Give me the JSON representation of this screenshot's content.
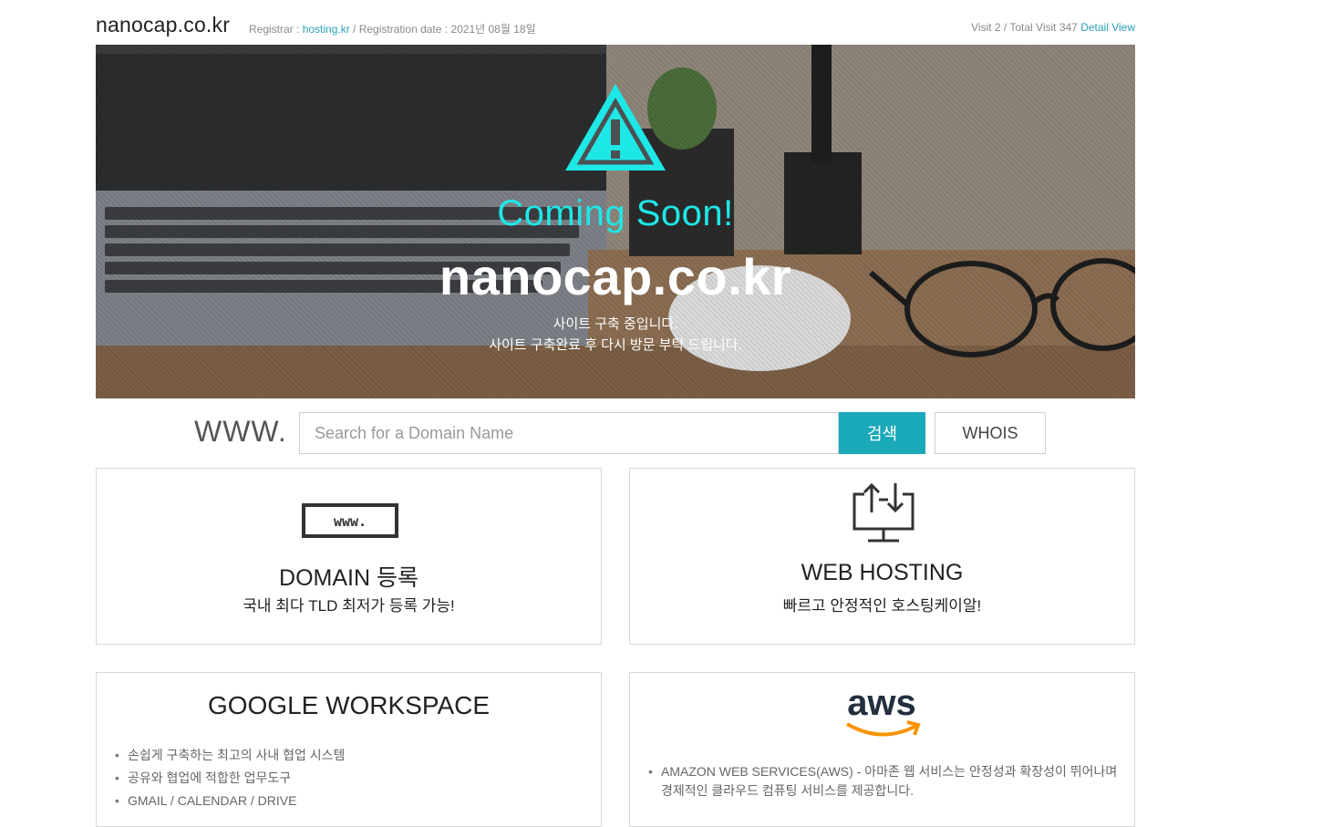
{
  "header": {
    "site_title": "nanocap.co.kr",
    "registrar_label": "Registrar : ",
    "registrar_name": "hosting.kr",
    "registration_label": " / Registration date : 2021년 08월 18일",
    "visit_text": "Visit 2 / Total Visit 347 ",
    "detail_link": "Detail View"
  },
  "hero": {
    "warning_icon": "warning-triangle-icon",
    "coming_soon": "Coming Soon!",
    "domain": "nanocap.co.kr",
    "message_line1": "사이트 구축 중입니다.",
    "message_line2": "사이트 구축완료 후 다시 방문 부탁 드립니다."
  },
  "search": {
    "prefix": "WWW.",
    "placeholder": "Search for a Domain Name",
    "value": "",
    "search_button": "검색",
    "whois_button": "WHOIS"
  },
  "cards": {
    "domain": {
      "icon": "www-icon",
      "icon_text": "www.",
      "title": "DOMAIN 등록",
      "subtitle": "국내 최다 TLD 최저가 등록 가능!"
    },
    "hosting": {
      "icon": "upload-download-monitor-icon",
      "title": "WEB HOSTING",
      "subtitle": "빠르고 안정적인 호스팅케이알!"
    },
    "google": {
      "title": "GOOGLE WORKSPACE",
      "items": [
        "손쉽게 구축하는 최고의 사내 협업 시스템",
        "공유와 협업에 적합한 업무도구",
        "GMAIL / CALENDAR / DRIVE"
      ]
    },
    "aws": {
      "icon": "aws-logo",
      "logo_text": "aws",
      "items": [
        "AMAZON WEB SERVICES(AWS) - 아마존 웹 서비스는 안정성과 확장성이 뛰어나며 경제적인 클라우드 컴퓨팅 서비스를 제공합니다."
      ]
    }
  },
  "colors": {
    "accent": "#1aa9b9",
    "link": "#2a9fb8",
    "coming_soon": "#1ee8e6",
    "aws_orange": "#f79400"
  }
}
